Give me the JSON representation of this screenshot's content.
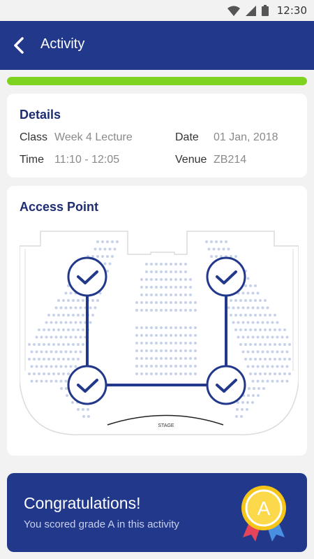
{
  "status": {
    "time": "12:30"
  },
  "header": {
    "title": "Activity"
  },
  "progress": {
    "fraction": 1.0
  },
  "details": {
    "title": "Details",
    "class_label": "Class",
    "class_value": "Week 4 Lecture",
    "date_label": "Date",
    "date_value": "01 Jan, 2018",
    "time_label": "Time",
    "time_value": "11:10 - 12:05",
    "venue_label": "Venue",
    "venue_value": "ZB214"
  },
  "access": {
    "title": "Access Point",
    "stage_label": "STAGE",
    "checkpoints_completed": 4
  },
  "banner": {
    "title": "Congratulations!",
    "subtitle": "You scored grade A in this activity",
    "grade": "A"
  },
  "colors": {
    "primary": "#22388a",
    "accent": "#7ed321",
    "gold": "#f5c518"
  }
}
